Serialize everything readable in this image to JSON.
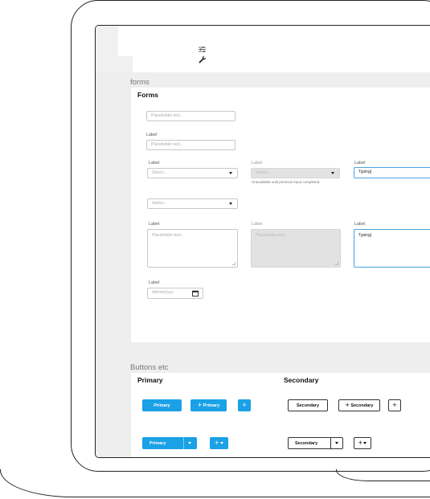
{
  "sections": {
    "forms_caption": "forms",
    "forms_title": "Forms",
    "buttons_caption": "Buttons etc",
    "primary_title": "Primary",
    "secondary_title": "Secondary"
  },
  "toolbar_icons": [
    "sliders-icon",
    "wrench-icon"
  ],
  "forms": {
    "plain_placeholder": "Placeholder text...",
    "labeled_label": "Label",
    "labeled_placeholder": "Placeholder text...",
    "select1_label": "Label",
    "select1_value": "Select...",
    "select2_label": "Label",
    "select2_value": "Select...",
    "select2_hint": "Unavailable until previous input completed.",
    "typing_label": "Label",
    "typing_value": "Typing|",
    "select3_value": "Select...",
    "ta1_label": "Label",
    "ta1_placeholder": "Placeholder text...",
    "ta2_label": "Label",
    "ta2_placeholder": "Placeholder text...",
    "ta3_label": "Label",
    "ta3_value": "Typing|",
    "date_label": "Label",
    "date_placeholder": "dd/mm/yyyy"
  },
  "buttons": {
    "primary": "Primary",
    "primary_plus": "Primary",
    "primary_split": "Primary",
    "secondary": "Secondary",
    "secondary_plus": "Secondary",
    "secondary_split": "Secondary",
    "plus_glyph": "+"
  },
  "colors": {
    "accent": "#1aa1e6",
    "focus": "#4aa3e0",
    "panel_bg": "#eeeeee"
  }
}
